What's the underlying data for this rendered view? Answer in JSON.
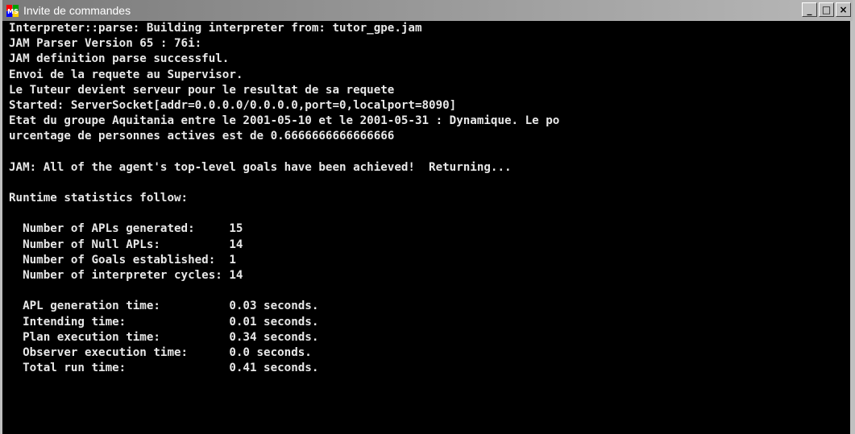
{
  "window": {
    "title": "Invite de commandes",
    "icon": "msdos-icon",
    "controls": {
      "minimize": "_",
      "maximize": "□",
      "close": "×"
    },
    "colors": {
      "background": "#000000",
      "text": "#e8e8e8"
    }
  },
  "console": {
    "lines": [
      "Interpreter::parse: Building interpreter from: tutor_gpe.jam",
      "JAM Parser Version 65 : 76i:",
      "JAM definition parse successful.",
      "Envoi de la requete au Supervisor.",
      "Le Tuteur devient serveur pour le resultat de sa requete",
      "Started: ServerSocket[addr=0.0.0.0/0.0.0.0,port=0,localport=8090]",
      "Etat du groupe Aquitania entre le 2001-05-10 et le 2001-05-31 : Dynamique. Le po",
      "urcentage de personnes actives est de 0.6666666666666666",
      "",
      "JAM: All of the agent's top-level goals have been achieved!  Returning...",
      "",
      "Runtime statistics follow:",
      "",
      "  Number of APLs generated:     15",
      "  Number of Null APLs:          14",
      "  Number of Goals established:  1",
      "  Number of interpreter cycles: 14",
      "",
      "  APL generation time:          0.03 seconds.",
      "  Intending time:               0.01 seconds.",
      "  Plan execution time:          0.34 seconds.",
      "  Observer execution time:      0.0 seconds.",
      "  Total run time:               0.41 seconds."
    ]
  }
}
